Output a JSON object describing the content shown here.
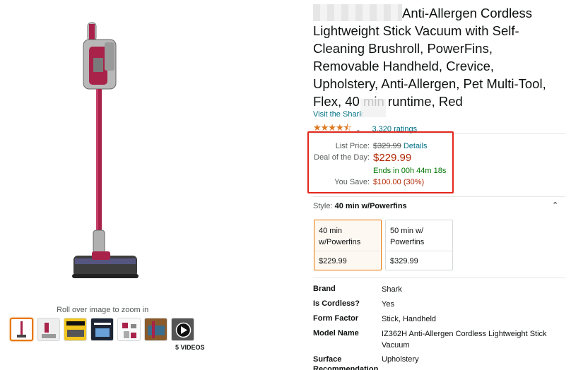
{
  "title": {
    "text": "Anti-Allergen Cordless Lightweight Stick Vacuum with Self-Cleaning Brushroll, PowerFins, Removable Handheld, Crevice, Upholstery, Anti-Allergen, Pet Multi-Tool, Flex, 40 min runtime, Red"
  },
  "store_link": "Visit the Shark",
  "rating": {
    "stars": "★★★★⯪",
    "stars_value": 4.5,
    "count": "3,320 ratings"
  },
  "price": {
    "list_label": "List Price:",
    "list_value": "$329.99",
    "details_link": "Details",
    "deal_label": "Deal of the Day:",
    "deal_value": "$229.99",
    "ends": "Ends in 00h 44m 18s",
    "save_label": "You Save:",
    "save_value": "$100.00 (30%)"
  },
  "style": {
    "label": "Style:",
    "selected": "40 min w/Powerfins",
    "options": [
      {
        "name": "40 min w/Powerfins",
        "price": "$229.99"
      },
      {
        "name": "50 min w/ Powerfins",
        "price": "$329.99"
      }
    ]
  },
  "specs": [
    {
      "label": "Brand",
      "value": "Shark"
    },
    {
      "label": "Is Cordless?",
      "value": "Yes"
    },
    {
      "label": "Form Factor",
      "value": "Stick, Handheld"
    },
    {
      "label": "Model Name",
      "value": "IZ362H Anti-Allergen Cordless Lightweight Stick Vacuum"
    },
    {
      "label": "Surface Recommendation",
      "value": "Upholstery"
    }
  ],
  "gallery": {
    "zoom_hint": "Roll over image to zoom in",
    "videos_label": "5 VIDEOS"
  },
  "colors": {
    "accent": "#e77600",
    "link": "#007185",
    "deal": "#b12704",
    "highlight_box": "#e3261b",
    "vacuum": "#a8224a"
  }
}
